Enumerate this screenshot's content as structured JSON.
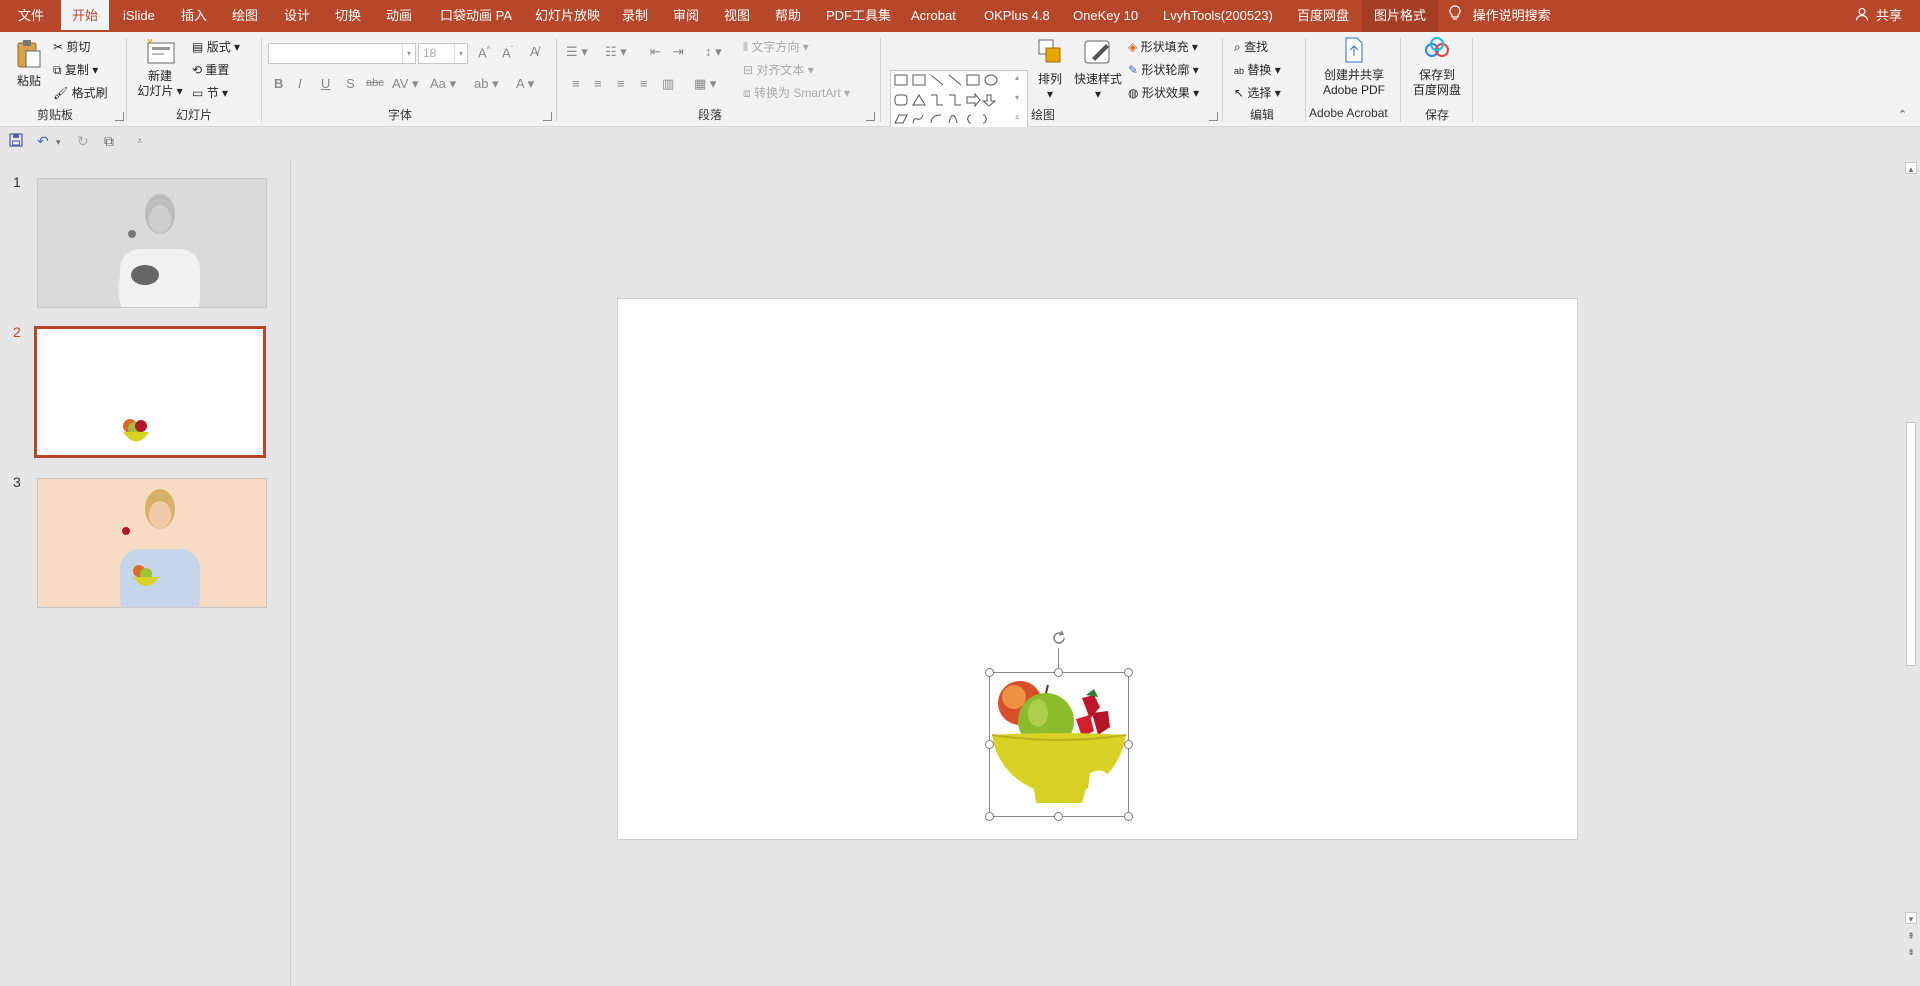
{
  "tabs": [
    {
      "label": "文件"
    },
    {
      "label": "开始"
    },
    {
      "label": "iSlide"
    },
    {
      "label": "插入"
    },
    {
      "label": "绘图"
    },
    {
      "label": "设计"
    },
    {
      "label": "切换"
    },
    {
      "label": "动画"
    },
    {
      "label": "口袋动画 PA"
    },
    {
      "label": "幻灯片放映"
    },
    {
      "label": "录制"
    },
    {
      "label": "审阅"
    },
    {
      "label": "视图"
    },
    {
      "label": "帮助"
    },
    {
      "label": "PDF工具集"
    },
    {
      "label": "Acrobat"
    },
    {
      "label": "OKPlus 4.8"
    },
    {
      "label": "OneKey 10"
    },
    {
      "label": "LvyhTools(200523)"
    },
    {
      "label": "百度网盘"
    },
    {
      "label": "图片格式"
    }
  ],
  "active_tab": "开始",
  "tell_me": "操作说明搜索",
  "share": "共享",
  "ribbon": {
    "clipboard": {
      "label": "剪贴板",
      "paste": "粘贴",
      "cut": "剪切",
      "copy": "复制",
      "format_painter": "格式刷"
    },
    "slides": {
      "label": "幻灯片",
      "new_slide_1": "新建",
      "new_slide_2": "幻灯片",
      "layout": "版式",
      "reset": "重置",
      "section": "节"
    },
    "font": {
      "label": "字体",
      "font_name": "",
      "font_size": "18"
    },
    "paragraph": {
      "label": "段落",
      "text_direction": "文字方向",
      "align_text": "对齐文本",
      "convert_smartart": "转换为 SmartArt"
    },
    "drawing": {
      "label": "绘图",
      "arrange": "排列",
      "quick_styles": "快速样式",
      "shape_fill": "形状填充",
      "shape_outline": "形状轮廓",
      "shape_effects": "形状效果"
    },
    "editing": {
      "label": "编辑",
      "find": "查找",
      "replace": "替换",
      "select": "选择"
    },
    "acrobat": {
      "label": "Adobe Acrobat",
      "create_1": "创建并共享",
      "create_2": "Adobe PDF"
    },
    "save": {
      "label": "保存",
      "save_1": "保存到",
      "save_2": "百度网盘"
    }
  },
  "thumbnails": [
    {
      "number": "1"
    },
    {
      "number": "2"
    },
    {
      "number": "3"
    }
  ],
  "colors": {
    "accent": "#b7472a",
    "ribbon_bg": "#f3f3f3",
    "workspace_bg": "#e6e6e6"
  }
}
